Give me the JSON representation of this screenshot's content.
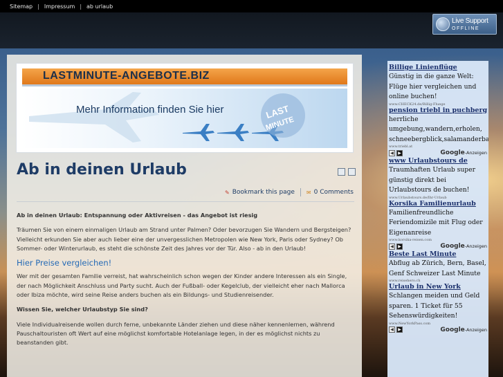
{
  "topnav": {
    "items": [
      "Sitemap",
      "Impressum",
      "ab urlaub"
    ],
    "separator": "|"
  },
  "live_support": {
    "line1": "Live Support",
    "line2": "OFFLINE"
  },
  "banner": {
    "site_name": "LASTMINUTE-ANGEBOTE.BIZ",
    "tagline": "Mehr Information finden Sie hier",
    "badge_line1": "LAST",
    "badge_line2": "MINUTE"
  },
  "article": {
    "title": "Ab in deinen Urlaub",
    "print_icon": "print-icon",
    "email_icon": "email-icon",
    "bookmark_label": "Bookmark this page",
    "comments_label": "0 Comments",
    "lead": "Ab in deinen Urlaub: Entspannung oder Aktivreisen - das Angebot ist riesig",
    "p1": "Träumen Sie von einem einmaligen Urlaub am Strand unter Palmen? Oder bevorzugen Sie Wandern und Bergsteigen? Vielleicht erkunden Sie aber auch lieber eine der unvergesslichen Metropolen wie New York, Paris oder Sydney? Ob Sommer- oder Winterurlaub, es steht die schönste Zeit des Jahres vor der Tür. Also - ab in den Urlaub!",
    "h2": "Hier Preise vergleichen!",
    "p2": "Wer mit der gesamten Familie verreist, hat wahrscheinlich schon wegen der Kinder andere Interessen als ein Single, der nach Möglichkeit Anschluss und Party sucht. Auch der Fußball- oder Kegelclub, der vielleicht eher nach Mallorca oder Ibiza möchte, wird seine Reise anders buchen als ein Bildungs- und Studienreisender.",
    "q": "Wissen Sie, welcher Urlaubstyp Sie sind?",
    "p3": "Viele Individualreisende wollen durch ferne, unbekannte Länder ziehen und diese näher kennenlernen, während Pauschaltouristen oft Wert auf eine möglichst komfortable Hotelanlage legen, in der es möglichst nichts zu beanstanden gibt."
  },
  "ads": {
    "google_label": "Google",
    "anzeigen_label": "-Anzeigen",
    "blocks": [
      {
        "items": [
          {
            "title": "Billige Linienflüge",
            "body": "Günstig in die ganze Welt: Flüge hier vergleichen und online buchen!",
            "url": "www.CHECK24.de/Billig-Fluege"
          },
          {
            "title": "pension triebl in puchberg",
            "body": "herrliche umgebung,wandern,erholen, schneebergblick,salamanderba",
            "url": "www.triebl.at"
          }
        ]
      },
      {
        "items": [
          {
            "title": "www Urlaubstours de",
            "body": "Traumhaften Urlaub super günstig direkt bei Urlaubstours de buchen!",
            "url": "www.Urlaubstours.de/Ihr-Urlaub"
          },
          {
            "title": "Korsika Familienurlaub",
            "body": "Familienfreundliche Feriendomizile mit Flug oder Eigenanreise",
            "url": "www.korsika-reisen.com"
          }
        ]
      },
      {
        "items": [
          {
            "title": "Beste Last Minute",
            "body": "Abflug ab Zürich, Bern, Basel, Genf Schweizer Last Minute",
            "url": "www.reisehero.ch"
          },
          {
            "title": "Urlaub in New York",
            "body": "Schlangen meiden und Geld sparen. 1 Ticket für 55 Sehenswürdigkeiten!",
            "url": "www.NewYorkPass.com"
          }
        ]
      }
    ]
  }
}
